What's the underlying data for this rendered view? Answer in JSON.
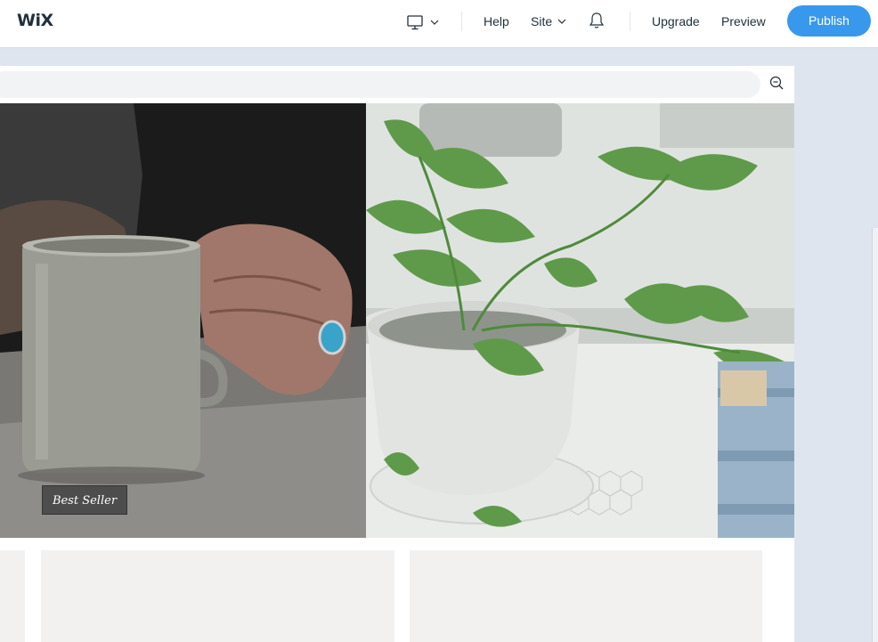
{
  "topbar": {
    "logo": "WiX",
    "device_icon": "desktop-icon",
    "help": "Help",
    "site": "Site",
    "notifications_icon": "bell-icon",
    "upgrade": "Upgrade",
    "preview": "Preview",
    "publish": "Publish"
  },
  "canvas": {
    "hero_left_image": "coffee-mug-photo",
    "hero_right_image": "potted-plant-photo",
    "products": [
      {
        "badge": "Best Seller"
      },
      {
        "badge": ""
      }
    ]
  },
  "colors": {
    "accent": "#3899ec",
    "text": "#20303c",
    "stage_bg": "#dfe5ee",
    "badge_bg": "#4d4d4d",
    "card_bg": "#f2f1f0"
  }
}
